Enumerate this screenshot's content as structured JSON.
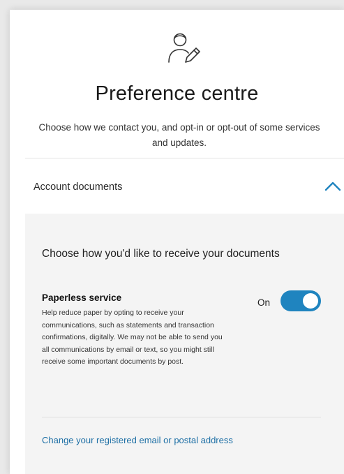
{
  "header": {
    "icon": "user-edit-icon",
    "title": "Preference centre",
    "intro": "Choose how we contact you, and opt-in or opt-out of some services and updates."
  },
  "section": {
    "label": "Account documents",
    "expanded": true,
    "chevron_icon": "chevron-up-icon"
  },
  "panel": {
    "heading": "Choose how you'd like to receive your documents",
    "service": {
      "title": "Paperless service",
      "description": "Help reduce paper by opting to receive your communications, such as statements and transaction confirmations, digitally. We may not be able to send you all communications by email or text, so you might still receive some important documents by post.",
      "toggle_label": "On",
      "toggle_on": true
    },
    "link": "Change your registered email or postal address"
  },
  "colors": {
    "accent": "#1f84bf",
    "link": "#1d6fa5",
    "panel_bg": "#f4f4f4"
  }
}
